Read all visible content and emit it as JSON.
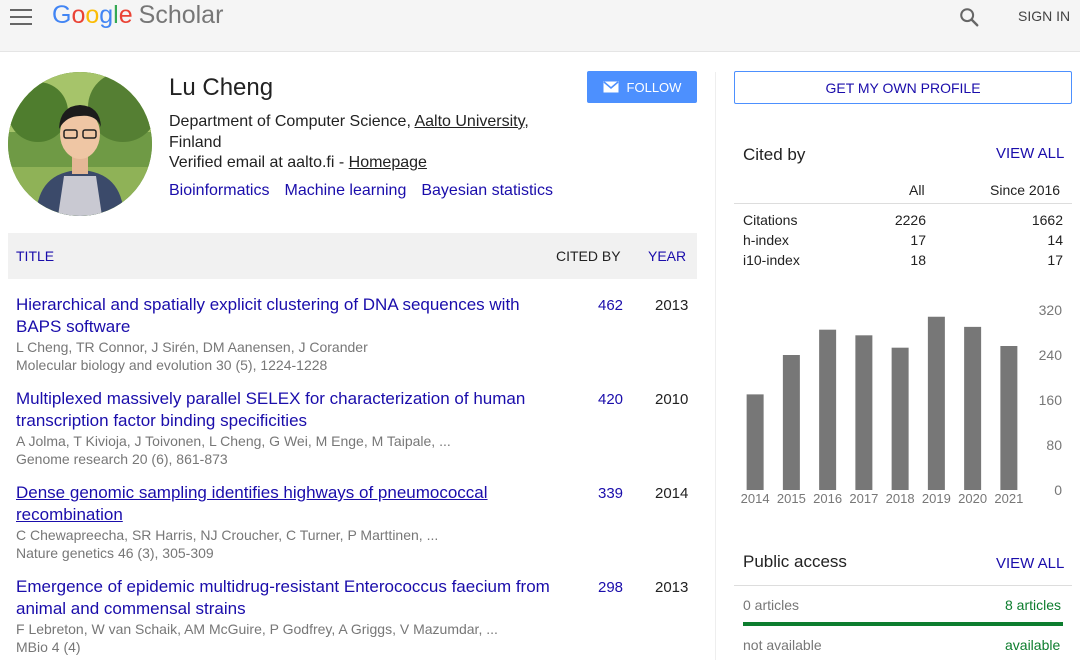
{
  "header": {
    "logo_google": [
      "G",
      "o",
      "o",
      "g",
      "l",
      "e"
    ],
    "logo_scholar": "Scholar",
    "signin_label": "SIGN IN"
  },
  "profile": {
    "name": "Lu Cheng",
    "affiliation_prefix": "Department of Computer Science, ",
    "affiliation_link": "Aalto University",
    "affiliation_suffix": ", Finland",
    "email_text": "Verified email at aalto.fi - ",
    "homepage_link": "Homepage",
    "interests": [
      "Bioinformatics",
      "Machine learning",
      "Bayesian statistics"
    ],
    "follow_label": "FOLLOW"
  },
  "table": {
    "col_title": "TITLE",
    "col_cited": "CITED BY",
    "col_year": "YEAR",
    "rows": [
      {
        "title": "Hierarchical and spatially explicit clustering of DNA sequences with BAPS software",
        "authors": "L Cheng, TR Connor, J Sirén, DM Aanensen, J Corander",
        "venue": "Molecular biology and evolution 30 (5), 1224-1228",
        "cited": "462",
        "year": "2013"
      },
      {
        "title": "Multiplexed massively parallel SELEX for characterization of human transcription factor binding specificities",
        "authors": "A Jolma, T Kivioja, J Toivonen, L Cheng, G Wei, M Enge, M Taipale, ...",
        "venue": "Genome research 20 (6), 861-873",
        "cited": "420",
        "year": "2010"
      },
      {
        "title": "Dense genomic sampling identifies highways of pneumococcal recombination",
        "authors": "C Chewapreecha, SR Harris, NJ Croucher, C Turner, P Marttinen, ...",
        "venue": "Nature genetics 46 (3), 305-309",
        "cited": "339",
        "year": "2014"
      },
      {
        "title": "Emergence of epidemic multidrug-resistant Enterococcus faecium from animal and commensal strains",
        "authors": "F Lebreton, W van Schaik, AM McGuire, P Godfrey, A Griggs, V Mazumdar, ...",
        "venue": "MBio 4 (4)",
        "cited": "298",
        "year": "2013"
      }
    ]
  },
  "sidebar": {
    "get_profile_label": "GET MY OWN PROFILE",
    "cited_by_title": "Cited by",
    "view_all_label": "VIEW ALL",
    "col_all": "All",
    "col_since": "Since 2016",
    "stats": [
      {
        "label": "Citations",
        "all": "2226",
        "since": "1662"
      },
      {
        "label": "h-index",
        "all": "17",
        "since": "14"
      },
      {
        "label": "i10-index",
        "all": "18",
        "since": "17"
      }
    ],
    "public_access_title": "Public access",
    "pa_view_all": "VIEW ALL",
    "pa_articles_left": "0 articles",
    "pa_articles_right": "8 articles",
    "pa_not_available": "not available",
    "pa_available": "available",
    "pa_available_fraction": 1.0
  },
  "chart_data": {
    "type": "bar",
    "categories": [
      "2014",
      "2015",
      "2016",
      "2017",
      "2018",
      "2019",
      "2020",
      "2021"
    ],
    "values": [
      170,
      240,
      285,
      275,
      253,
      308,
      290,
      256
    ],
    "yticks": [
      0,
      80,
      160,
      240,
      320
    ],
    "ylim": [
      0,
      320
    ],
    "bar_color": "#777777"
  }
}
